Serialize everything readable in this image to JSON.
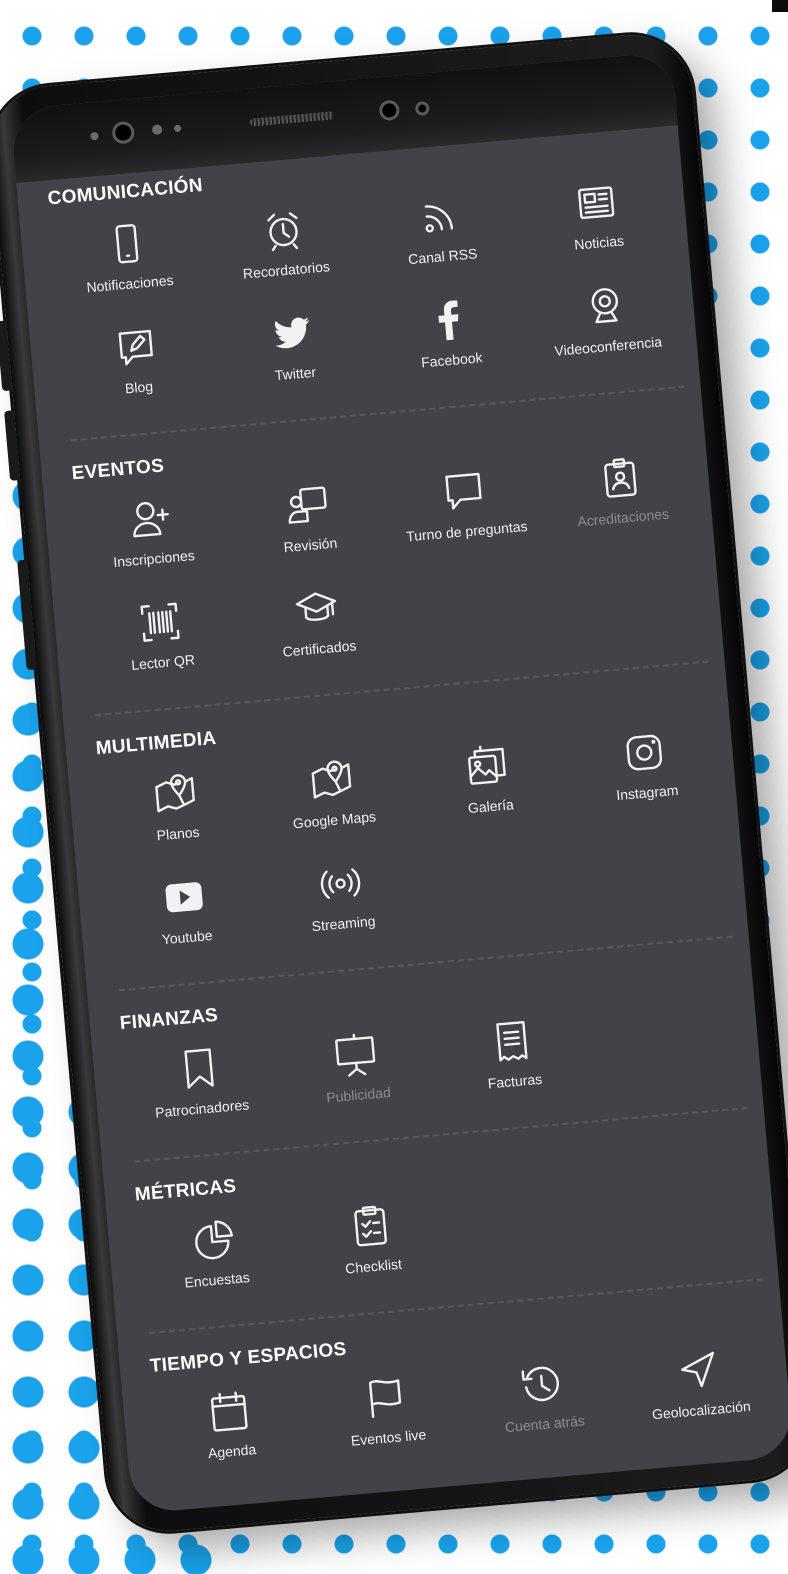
{
  "sections": [
    {
      "title": "COMUNICACIÓN",
      "items": [
        {
          "label": "Notificaciones",
          "icon": "phone-icon"
        },
        {
          "label": "Recordatorios",
          "icon": "alarm-clock-icon"
        },
        {
          "label": "Canal RSS",
          "icon": "rss-icon"
        },
        {
          "label": "Noticias",
          "icon": "newspaper-icon"
        },
        {
          "label": "Blog",
          "icon": "blog-pencil-icon"
        },
        {
          "label": "Twitter",
          "icon": "twitter-icon"
        },
        {
          "label": "Facebook",
          "icon": "facebook-icon"
        },
        {
          "label": "Videoconferencia",
          "icon": "webcam-icon"
        }
      ]
    },
    {
      "title": "EVENTOS",
      "items": [
        {
          "label": "Inscripciones",
          "icon": "add-user-icon"
        },
        {
          "label": "Revisión",
          "icon": "presenter-icon"
        },
        {
          "label": "Turno de preguntas",
          "icon": "speech-bubble-icon"
        },
        {
          "label": "Acreditaciones",
          "icon": "badge-icon",
          "dim": true
        },
        {
          "label": "Lector QR",
          "icon": "barcode-scanner-icon"
        },
        {
          "label": "Certificados",
          "icon": "graduation-cap-icon"
        }
      ]
    },
    {
      "title": "MULTIMEDIA",
      "items": [
        {
          "label": "Planos",
          "icon": "map-pin-icon"
        },
        {
          "label": "Google Maps",
          "icon": "map-pin-icon"
        },
        {
          "label": "Galería",
          "icon": "gallery-icon"
        },
        {
          "label": "Instagram",
          "icon": "instagram-icon"
        },
        {
          "label": "Youtube",
          "icon": "youtube-icon"
        },
        {
          "label": "Streaming",
          "icon": "broadcast-icon"
        }
      ]
    },
    {
      "title": "FINANZAS",
      "items": [
        {
          "label": "Patrocinadores",
          "icon": "bookmark-icon"
        },
        {
          "label": "Publicidad",
          "icon": "presentation-board-icon",
          "dim": true
        },
        {
          "label": "Facturas",
          "icon": "receipt-icon"
        }
      ]
    },
    {
      "title": "MÉTRICAS",
      "items": [
        {
          "label": "Encuestas",
          "icon": "pie-chart-icon"
        },
        {
          "label": "Checklist",
          "icon": "clipboard-check-icon"
        }
      ]
    },
    {
      "title": "TIEMPO Y ESPACIOS",
      "items": [
        {
          "label": "Agenda",
          "icon": "calendar-icon"
        },
        {
          "label": "Eventos live",
          "icon": "flag-icon"
        },
        {
          "label": "Cuenta atrás",
          "icon": "history-icon",
          "dim": true
        },
        {
          "label": "Geolocalización",
          "icon": "navigation-arrow-icon"
        }
      ]
    }
  ],
  "colors": {
    "dots": "#1aa3ec",
    "screen": "#414349",
    "text": "#f1f1f1",
    "dim_text": "#8b8d93"
  }
}
